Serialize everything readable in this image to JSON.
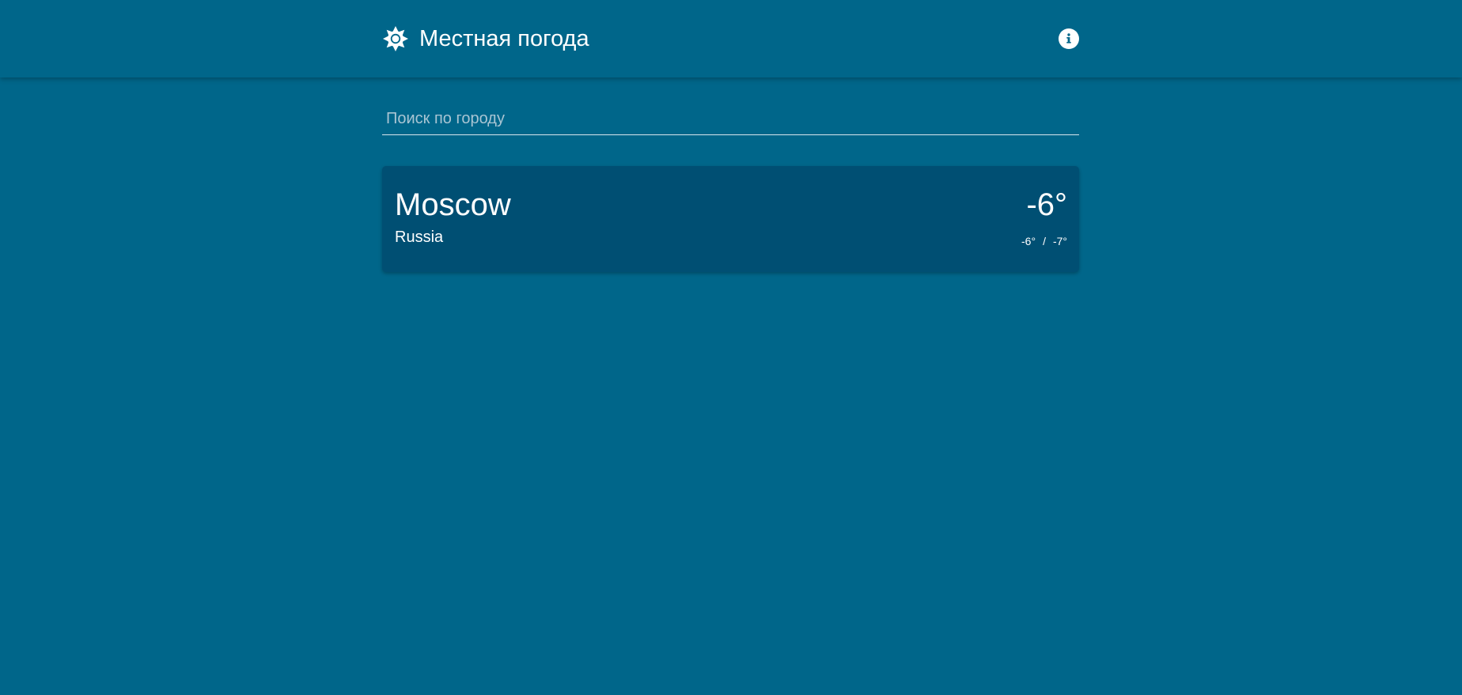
{
  "header": {
    "title": "Местная погода",
    "logo_icon": "sun-icon",
    "info_icon": "info-icon"
  },
  "search": {
    "placeholder": "Поиск по городу",
    "value": ""
  },
  "cities": [
    {
      "name": "Moscow",
      "country": "Russia",
      "temp_current": "-6°",
      "temp_high": "-6°",
      "temp_separator": "/",
      "temp_low": "-7°"
    }
  ],
  "colors": {
    "background": "#00668a",
    "card": "#004f73",
    "text": "#ffffff"
  }
}
